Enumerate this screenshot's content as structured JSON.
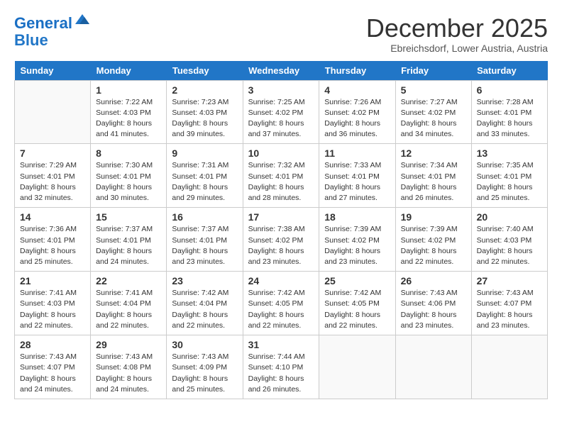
{
  "header": {
    "logo_line1": "General",
    "logo_line2": "Blue",
    "month": "December 2025",
    "location": "Ebreichsdorf, Lower Austria, Austria"
  },
  "days_of_week": [
    "Sunday",
    "Monday",
    "Tuesday",
    "Wednesday",
    "Thursday",
    "Friday",
    "Saturday"
  ],
  "weeks": [
    [
      {
        "num": "",
        "info": ""
      },
      {
        "num": "1",
        "info": "Sunrise: 7:22 AM\nSunset: 4:03 PM\nDaylight: 8 hours\nand 41 minutes."
      },
      {
        "num": "2",
        "info": "Sunrise: 7:23 AM\nSunset: 4:03 PM\nDaylight: 8 hours\nand 39 minutes."
      },
      {
        "num": "3",
        "info": "Sunrise: 7:25 AM\nSunset: 4:02 PM\nDaylight: 8 hours\nand 37 minutes."
      },
      {
        "num": "4",
        "info": "Sunrise: 7:26 AM\nSunset: 4:02 PM\nDaylight: 8 hours\nand 36 minutes."
      },
      {
        "num": "5",
        "info": "Sunrise: 7:27 AM\nSunset: 4:02 PM\nDaylight: 8 hours\nand 34 minutes."
      },
      {
        "num": "6",
        "info": "Sunrise: 7:28 AM\nSunset: 4:01 PM\nDaylight: 8 hours\nand 33 minutes."
      }
    ],
    [
      {
        "num": "7",
        "info": "Sunrise: 7:29 AM\nSunset: 4:01 PM\nDaylight: 8 hours\nand 32 minutes."
      },
      {
        "num": "8",
        "info": "Sunrise: 7:30 AM\nSunset: 4:01 PM\nDaylight: 8 hours\nand 30 minutes."
      },
      {
        "num": "9",
        "info": "Sunrise: 7:31 AM\nSunset: 4:01 PM\nDaylight: 8 hours\nand 29 minutes."
      },
      {
        "num": "10",
        "info": "Sunrise: 7:32 AM\nSunset: 4:01 PM\nDaylight: 8 hours\nand 28 minutes."
      },
      {
        "num": "11",
        "info": "Sunrise: 7:33 AM\nSunset: 4:01 PM\nDaylight: 8 hours\nand 27 minutes."
      },
      {
        "num": "12",
        "info": "Sunrise: 7:34 AM\nSunset: 4:01 PM\nDaylight: 8 hours\nand 26 minutes."
      },
      {
        "num": "13",
        "info": "Sunrise: 7:35 AM\nSunset: 4:01 PM\nDaylight: 8 hours\nand 25 minutes."
      }
    ],
    [
      {
        "num": "14",
        "info": "Sunrise: 7:36 AM\nSunset: 4:01 PM\nDaylight: 8 hours\nand 25 minutes."
      },
      {
        "num": "15",
        "info": "Sunrise: 7:37 AM\nSunset: 4:01 PM\nDaylight: 8 hours\nand 24 minutes."
      },
      {
        "num": "16",
        "info": "Sunrise: 7:37 AM\nSunset: 4:01 PM\nDaylight: 8 hours\nand 23 minutes."
      },
      {
        "num": "17",
        "info": "Sunrise: 7:38 AM\nSunset: 4:02 PM\nDaylight: 8 hours\nand 23 minutes."
      },
      {
        "num": "18",
        "info": "Sunrise: 7:39 AM\nSunset: 4:02 PM\nDaylight: 8 hours\nand 23 minutes."
      },
      {
        "num": "19",
        "info": "Sunrise: 7:39 AM\nSunset: 4:02 PM\nDaylight: 8 hours\nand 22 minutes."
      },
      {
        "num": "20",
        "info": "Sunrise: 7:40 AM\nSunset: 4:03 PM\nDaylight: 8 hours\nand 22 minutes."
      }
    ],
    [
      {
        "num": "21",
        "info": "Sunrise: 7:41 AM\nSunset: 4:03 PM\nDaylight: 8 hours\nand 22 minutes."
      },
      {
        "num": "22",
        "info": "Sunrise: 7:41 AM\nSunset: 4:04 PM\nDaylight: 8 hours\nand 22 minutes."
      },
      {
        "num": "23",
        "info": "Sunrise: 7:42 AM\nSunset: 4:04 PM\nDaylight: 8 hours\nand 22 minutes."
      },
      {
        "num": "24",
        "info": "Sunrise: 7:42 AM\nSunset: 4:05 PM\nDaylight: 8 hours\nand 22 minutes."
      },
      {
        "num": "25",
        "info": "Sunrise: 7:42 AM\nSunset: 4:05 PM\nDaylight: 8 hours\nand 22 minutes."
      },
      {
        "num": "26",
        "info": "Sunrise: 7:43 AM\nSunset: 4:06 PM\nDaylight: 8 hours\nand 23 minutes."
      },
      {
        "num": "27",
        "info": "Sunrise: 7:43 AM\nSunset: 4:07 PM\nDaylight: 8 hours\nand 23 minutes."
      }
    ],
    [
      {
        "num": "28",
        "info": "Sunrise: 7:43 AM\nSunset: 4:07 PM\nDaylight: 8 hours\nand 24 minutes."
      },
      {
        "num": "29",
        "info": "Sunrise: 7:43 AM\nSunset: 4:08 PM\nDaylight: 8 hours\nand 24 minutes."
      },
      {
        "num": "30",
        "info": "Sunrise: 7:43 AM\nSunset: 4:09 PM\nDaylight: 8 hours\nand 25 minutes."
      },
      {
        "num": "31",
        "info": "Sunrise: 7:44 AM\nSunset: 4:10 PM\nDaylight: 8 hours\nand 26 minutes."
      },
      {
        "num": "",
        "info": ""
      },
      {
        "num": "",
        "info": ""
      },
      {
        "num": "",
        "info": ""
      }
    ]
  ]
}
